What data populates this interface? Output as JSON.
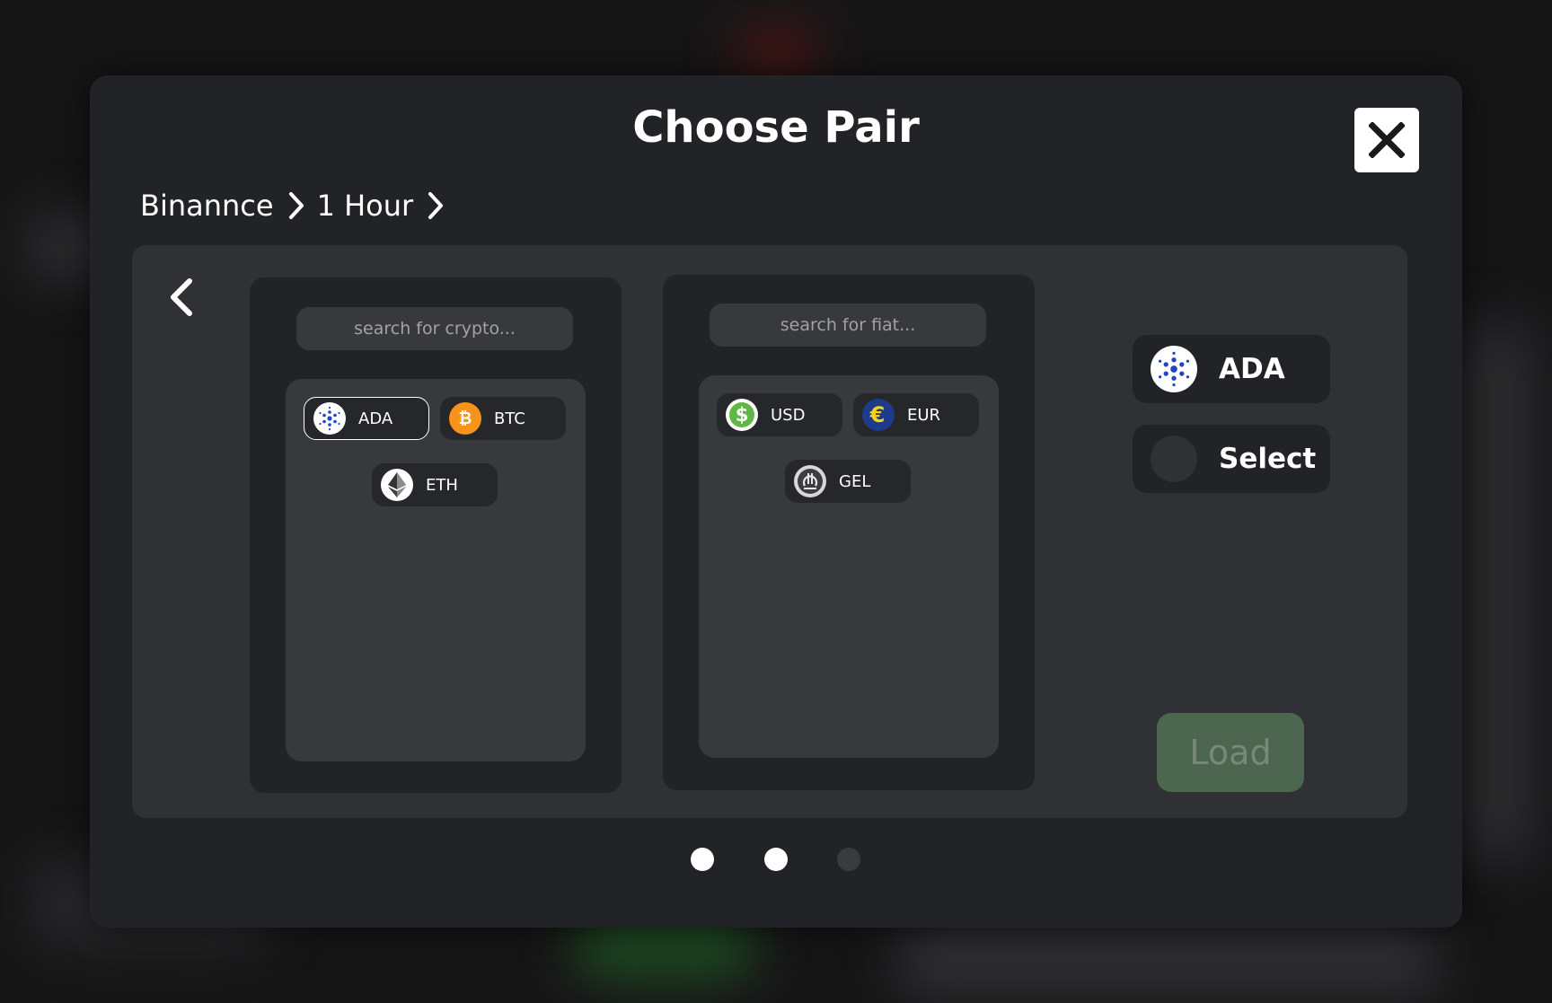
{
  "modal": {
    "title": "Choose Pair",
    "breadcrumb": [
      "Binannce",
      "1 Hour"
    ]
  },
  "crypto_panel": {
    "search_placeholder": "search for crypto...",
    "items": [
      {
        "label": "ADA",
        "icon": "cardano-icon",
        "selected": true
      },
      {
        "label": "BTC",
        "icon": "bitcoin-icon",
        "selected": false
      },
      {
        "label": "ETH",
        "icon": "ethereum-icon",
        "selected": false
      }
    ]
  },
  "fiat_panel": {
    "search_placeholder": "search for fiat...",
    "items": [
      {
        "label": "USD",
        "icon": "dollar-icon"
      },
      {
        "label": "EUR",
        "icon": "euro-icon"
      },
      {
        "label": "GEL",
        "icon": "lari-icon"
      }
    ]
  },
  "selection": {
    "first": {
      "label": "ADA",
      "icon": "cardano-icon"
    },
    "second": {
      "label": "Select",
      "icon": "empty-circle-icon"
    }
  },
  "load_button": {
    "label": "Load"
  },
  "pagination": {
    "total": 3,
    "active": [
      true,
      true,
      false
    ]
  },
  "colors": {
    "modal_bg": "#222326",
    "content_bg": "#303134",
    "load_button_bg": "#4d6650",
    "dot_active": "#ffffff",
    "dot_inactive": "#3a3b3e"
  }
}
